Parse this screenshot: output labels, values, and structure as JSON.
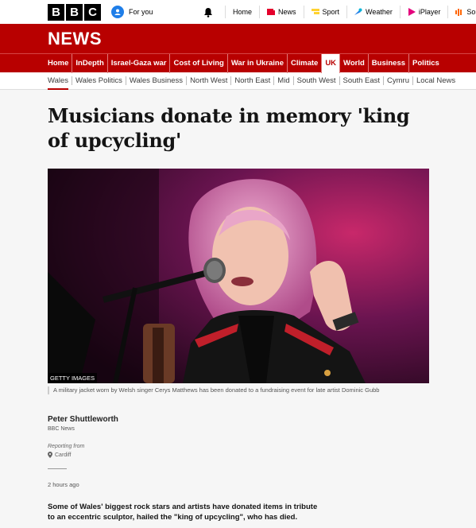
{
  "header": {
    "logo_letters": [
      "B",
      "B",
      "C"
    ],
    "for_you": "For you",
    "nav": [
      {
        "label": "Home",
        "icon": "none"
      },
      {
        "label": "News",
        "icon": "news-icon",
        "color": "#e4002b"
      },
      {
        "label": "Sport",
        "icon": "sport-icon",
        "color": "#ffd230"
      },
      {
        "label": "Weather",
        "icon": "weather-icon",
        "color": "#1f7ee8"
      },
      {
        "label": "iPlayer",
        "icon": "iplayer-icon",
        "color": "#e4007c"
      },
      {
        "label": "Sounds",
        "icon": "sounds-icon",
        "color": "#ff6600"
      }
    ]
  },
  "brand": {
    "title": "NEWS",
    "color": "#b80000"
  },
  "sections": [
    "Home",
    "InDepth",
    "Israel-Gaza war",
    "Cost of Living",
    "War in Ukraine",
    "Climate",
    "UK",
    "World",
    "Business",
    "Politics"
  ],
  "subsections": [
    "Wales",
    "Wales Politics",
    "Wales Business",
    "North West",
    "North East",
    "Mid",
    "South West",
    "South East",
    "Cymru",
    "Local News"
  ],
  "article": {
    "headline": "Musicians donate in memory 'king of upcycling'",
    "image_credit": "GETTY IMAGES",
    "caption": "A military jacket worn by Welsh singer Cerys Matthews has been donated to a fundraising event for late artist Dominic Gubb",
    "author": "Peter Shuttleworth",
    "organisation": "BBC News",
    "reporting_from": "Reporting from",
    "location": "Cardiff",
    "timestamp": "2 hours ago",
    "lead": "Some of Wales' biggest rock stars and artists have donated items in tribute to an eccentric sculptor, hailed the \"king of upcycling\", who has died."
  }
}
